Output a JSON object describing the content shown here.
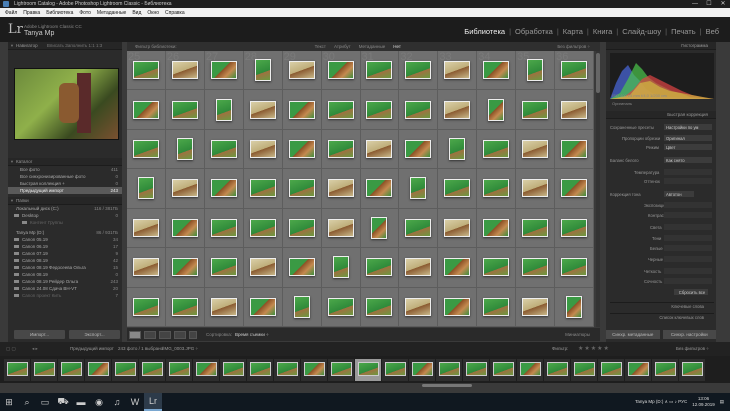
{
  "window": {
    "title": "Lightroom Catalog - Adobe Photoshop Lightroom Classic - Библиотека",
    "controls": [
      "—",
      "☐",
      "✕"
    ]
  },
  "menu": [
    "Файл",
    "Правка",
    "Библиотека",
    "Фото",
    "Метаданные",
    "Вид",
    "Окно",
    "Справка"
  ],
  "identity": {
    "logo": "Lr",
    "catalog": "Adobe Lightroom Classic CC",
    "user": "Tanya Mp"
  },
  "modules": [
    "Библиотека",
    "Обработка",
    "Карта",
    "Книга",
    "Слайд-шоу",
    "Печать",
    "Веб"
  ],
  "active_module": "Библиотека",
  "left": {
    "navigator": {
      "title": "Навигатор",
      "modes": "Вписать  Заполнить  1:1  1:3"
    },
    "catalog": {
      "title": "Каталог",
      "items": [
        {
          "label": "Все фото",
          "count": "411"
        },
        {
          "label": "Все синхронизированные фото",
          "count": "0"
        },
        {
          "label": "Быстрая коллекция +",
          "count": "0"
        },
        {
          "label": "Предыдущий импорт",
          "count": "243"
        }
      ]
    },
    "folders": {
      "title": "Папки",
      "disk1": {
        "label": "Локальный диск (C:)",
        "info": "116 / 381ГБ"
      },
      "disk1_items": [
        {
          "label": "Desktop",
          "count": "0"
        },
        {
          "label": "Контент Группы",
          "count": ""
        }
      ],
      "disk2": {
        "label": "Tanya Mp (D:)",
        "info": "86 / 931ГБ"
      },
      "disk2_items": [
        {
          "label": "Canon 05.19",
          "count": "34"
        },
        {
          "label": "Canon 06.19",
          "count": "17"
        },
        {
          "label": "Canon 07.19",
          "count": "9"
        },
        {
          "label": "Canon 08.19",
          "count": "42"
        },
        {
          "label": "Canon 08.19 Федосеева Ольга",
          "count": "15"
        },
        {
          "label": "Canon 08.19",
          "count": "0"
        },
        {
          "label": "Canon 08.19 Рейдер Ольга",
          "count": "243"
        },
        {
          "label": "Canon 24.08 Сдача ВН-VT",
          "count": "20"
        },
        {
          "label": "Canon проект Кить",
          "count": "7"
        }
      ]
    },
    "buttons": {
      "import": "Импорт...",
      "export": "Экспорт..."
    }
  },
  "filterbar": {
    "title": "Фильтр библиотеки:",
    "items": [
      "Текст",
      "Атрибут",
      "Метаданные",
      "Нет"
    ],
    "active": "Нет",
    "preset": "Без фильтров ÷"
  },
  "grid": {
    "numbers": [
      "25",
      "26",
      "27",
      "28",
      "29",
      "30",
      "31",
      "32",
      "33",
      "34",
      "35",
      "36"
    ],
    "patterns": [
      "green",
      "sand",
      "mix",
      "green",
      "sand",
      "mix",
      "green",
      "green",
      "sand",
      "mix",
      "green",
      "green"
    ]
  },
  "toolbar": {
    "sort_label": "Сортировка:",
    "sort_value": "Время съемки ÷",
    "thumbs_label": "Миниатюры"
  },
  "right": {
    "histogram": {
      "title": "Гистограмма",
      "info": "ISO 400   24 mm   f/4.0   1/200 сек",
      "original": "Оригиналь"
    },
    "quick": {
      "title": "Быстрая коррекция",
      "rows": [
        {
          "label": "Сохраненные пресеты",
          "value": "Настройки по ум"
        },
        {
          "label": "Пропорции обрезки",
          "value": "Оригинал"
        },
        {
          "label": "Режим",
          "value": "Цвет"
        },
        {
          "label": "Баланс белого",
          "value": "Как снято"
        },
        {
          "label": "Температура",
          "value": ""
        },
        {
          "label": "Оттенок",
          "value": ""
        },
        {
          "label": "Коррекция тона",
          "value": "Автотон"
        },
        {
          "label": "Экспозиция",
          "value": ""
        },
        {
          "label": "Контраст",
          "value": ""
        },
        {
          "label": "Света",
          "value": ""
        },
        {
          "label": "Тени",
          "value": ""
        },
        {
          "label": "Белые",
          "value": ""
        },
        {
          "label": "Черные",
          "value": ""
        },
        {
          "label": "Четкость",
          "value": ""
        },
        {
          "label": "Сочность",
          "value": ""
        }
      ],
      "reset": "Сбросить все"
    },
    "keywords": "Ключевые слова",
    "keyword_list": "Список ключевых слов",
    "buttons": {
      "sync_meta": "Синхр. метаданные",
      "sync_settings": "Синхр. настройки"
    }
  },
  "filmstrip_bar": {
    "source": "Предыдущий импорт",
    "count": "243 фото / 1 выбрано",
    "file": "/IMG_0003.JPG ÷",
    "filter_label": "Фильтр:",
    "filter_preset": "Без фильтров ÷"
  },
  "taskbar": {
    "icons": [
      "windows-icon",
      "search-icon",
      "task-view-icon",
      "store-icon",
      "explorer-icon",
      "chrome-icon",
      "media-icon",
      "word-icon",
      "lightroom-icon"
    ],
    "tray": "Tanya Mp (D:)   ∧  ▭  ♪  РУС",
    "time": "13:06",
    "date": "12.09.2019"
  },
  "colors": {
    "grid_bg": "#6a6a6a",
    "active_module": "#eeeeee",
    "selected_row": "#5a5a5a",
    "taskbar": "#101820"
  }
}
